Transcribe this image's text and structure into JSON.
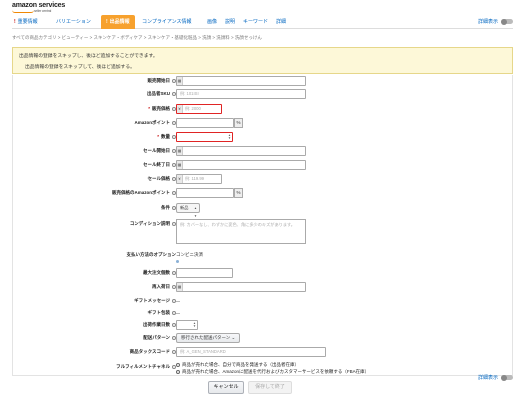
{
  "header": {
    "logo_text": "amazon services",
    "logo_sub": "seller central"
  },
  "tabs": [
    {
      "label": "重要情報",
      "alert": true
    },
    {
      "label": "バリエーション",
      "alert": false
    },
    {
      "label": "出品情報",
      "alert": true,
      "active": true
    },
    {
      "label": "コンプライアンス情報",
      "alert": false
    },
    {
      "label": "画像",
      "alert": false
    },
    {
      "label": "説明",
      "alert": false
    },
    {
      "label": "キーワード",
      "alert": false
    },
    {
      "label": "詳細",
      "alert": false
    }
  ],
  "advanced_view_label": "詳細表示",
  "breadcrumb": "すべての商品カテゴリ > ビューティー > スキンケア・ボディケア > スキンケア・基礎化粧品 > 洗顔 > 洗顔料 > 洗顔せっけん",
  "banner": {
    "line1": "出品情報の登録をスキップし、後ほど追加することができます。",
    "line2": "出品情報の登録をスキップして、後ほど追加する。"
  },
  "form": {
    "release_date": {
      "label": "販売開始日"
    },
    "seller_sku": {
      "label": "出品者SKU",
      "placeholder": "例: 101ISI"
    },
    "price": {
      "label": "販売価格",
      "required": true,
      "placeholder": "例: 2000",
      "currency": "¥"
    },
    "amazon_points": {
      "label": "Amazonポイント",
      "unit": "%"
    },
    "quantity": {
      "label": "数量",
      "required": true
    },
    "sale_start": {
      "label": "セール開始日"
    },
    "sale_end": {
      "label": "セール終了日"
    },
    "sale_price": {
      "label": "セール価格",
      "placeholder": "例: 119.99",
      "currency": "¥"
    },
    "sale_points": {
      "label": "販売価格のAmazonポイント",
      "unit": "%"
    },
    "condition": {
      "label": "条件",
      "value": "新品"
    },
    "condition_note": {
      "label": "コンディション説明",
      "placeholder": "例: カバーなし、わずかに変色、角に多少のキズがあります。"
    },
    "payment": {
      "label": "支払い方法のオプション",
      "value": "コンビニ決済"
    },
    "max_order": {
      "label": "最大注文個数"
    },
    "restock_date": {
      "label": "再入荷日"
    },
    "gift_message": {
      "label": "ギフトメッセージ"
    },
    "gift_wrap": {
      "label": "ギフト包装"
    },
    "lead_time": {
      "label": "出荷作業日数"
    },
    "shipping_template": {
      "label": "配送パターン",
      "value": "移行された配送パターン"
    },
    "tax_code": {
      "label": "商品タックスコード",
      "placeholder": "例: A_GEN_STANDARD"
    },
    "fulfillment": {
      "label": "フルフィルメントチャネル",
      "option1": "商品が売れた場合、自分で商品を発送する（出品者在庫）",
      "option2": "商品が売れた場合、Amazonに配送を代行およびカスタマーサービスを依頼する（FBA在庫）"
    }
  },
  "footer": {
    "cancel_label": "キャンセル",
    "save_label": "保存して終了"
  }
}
